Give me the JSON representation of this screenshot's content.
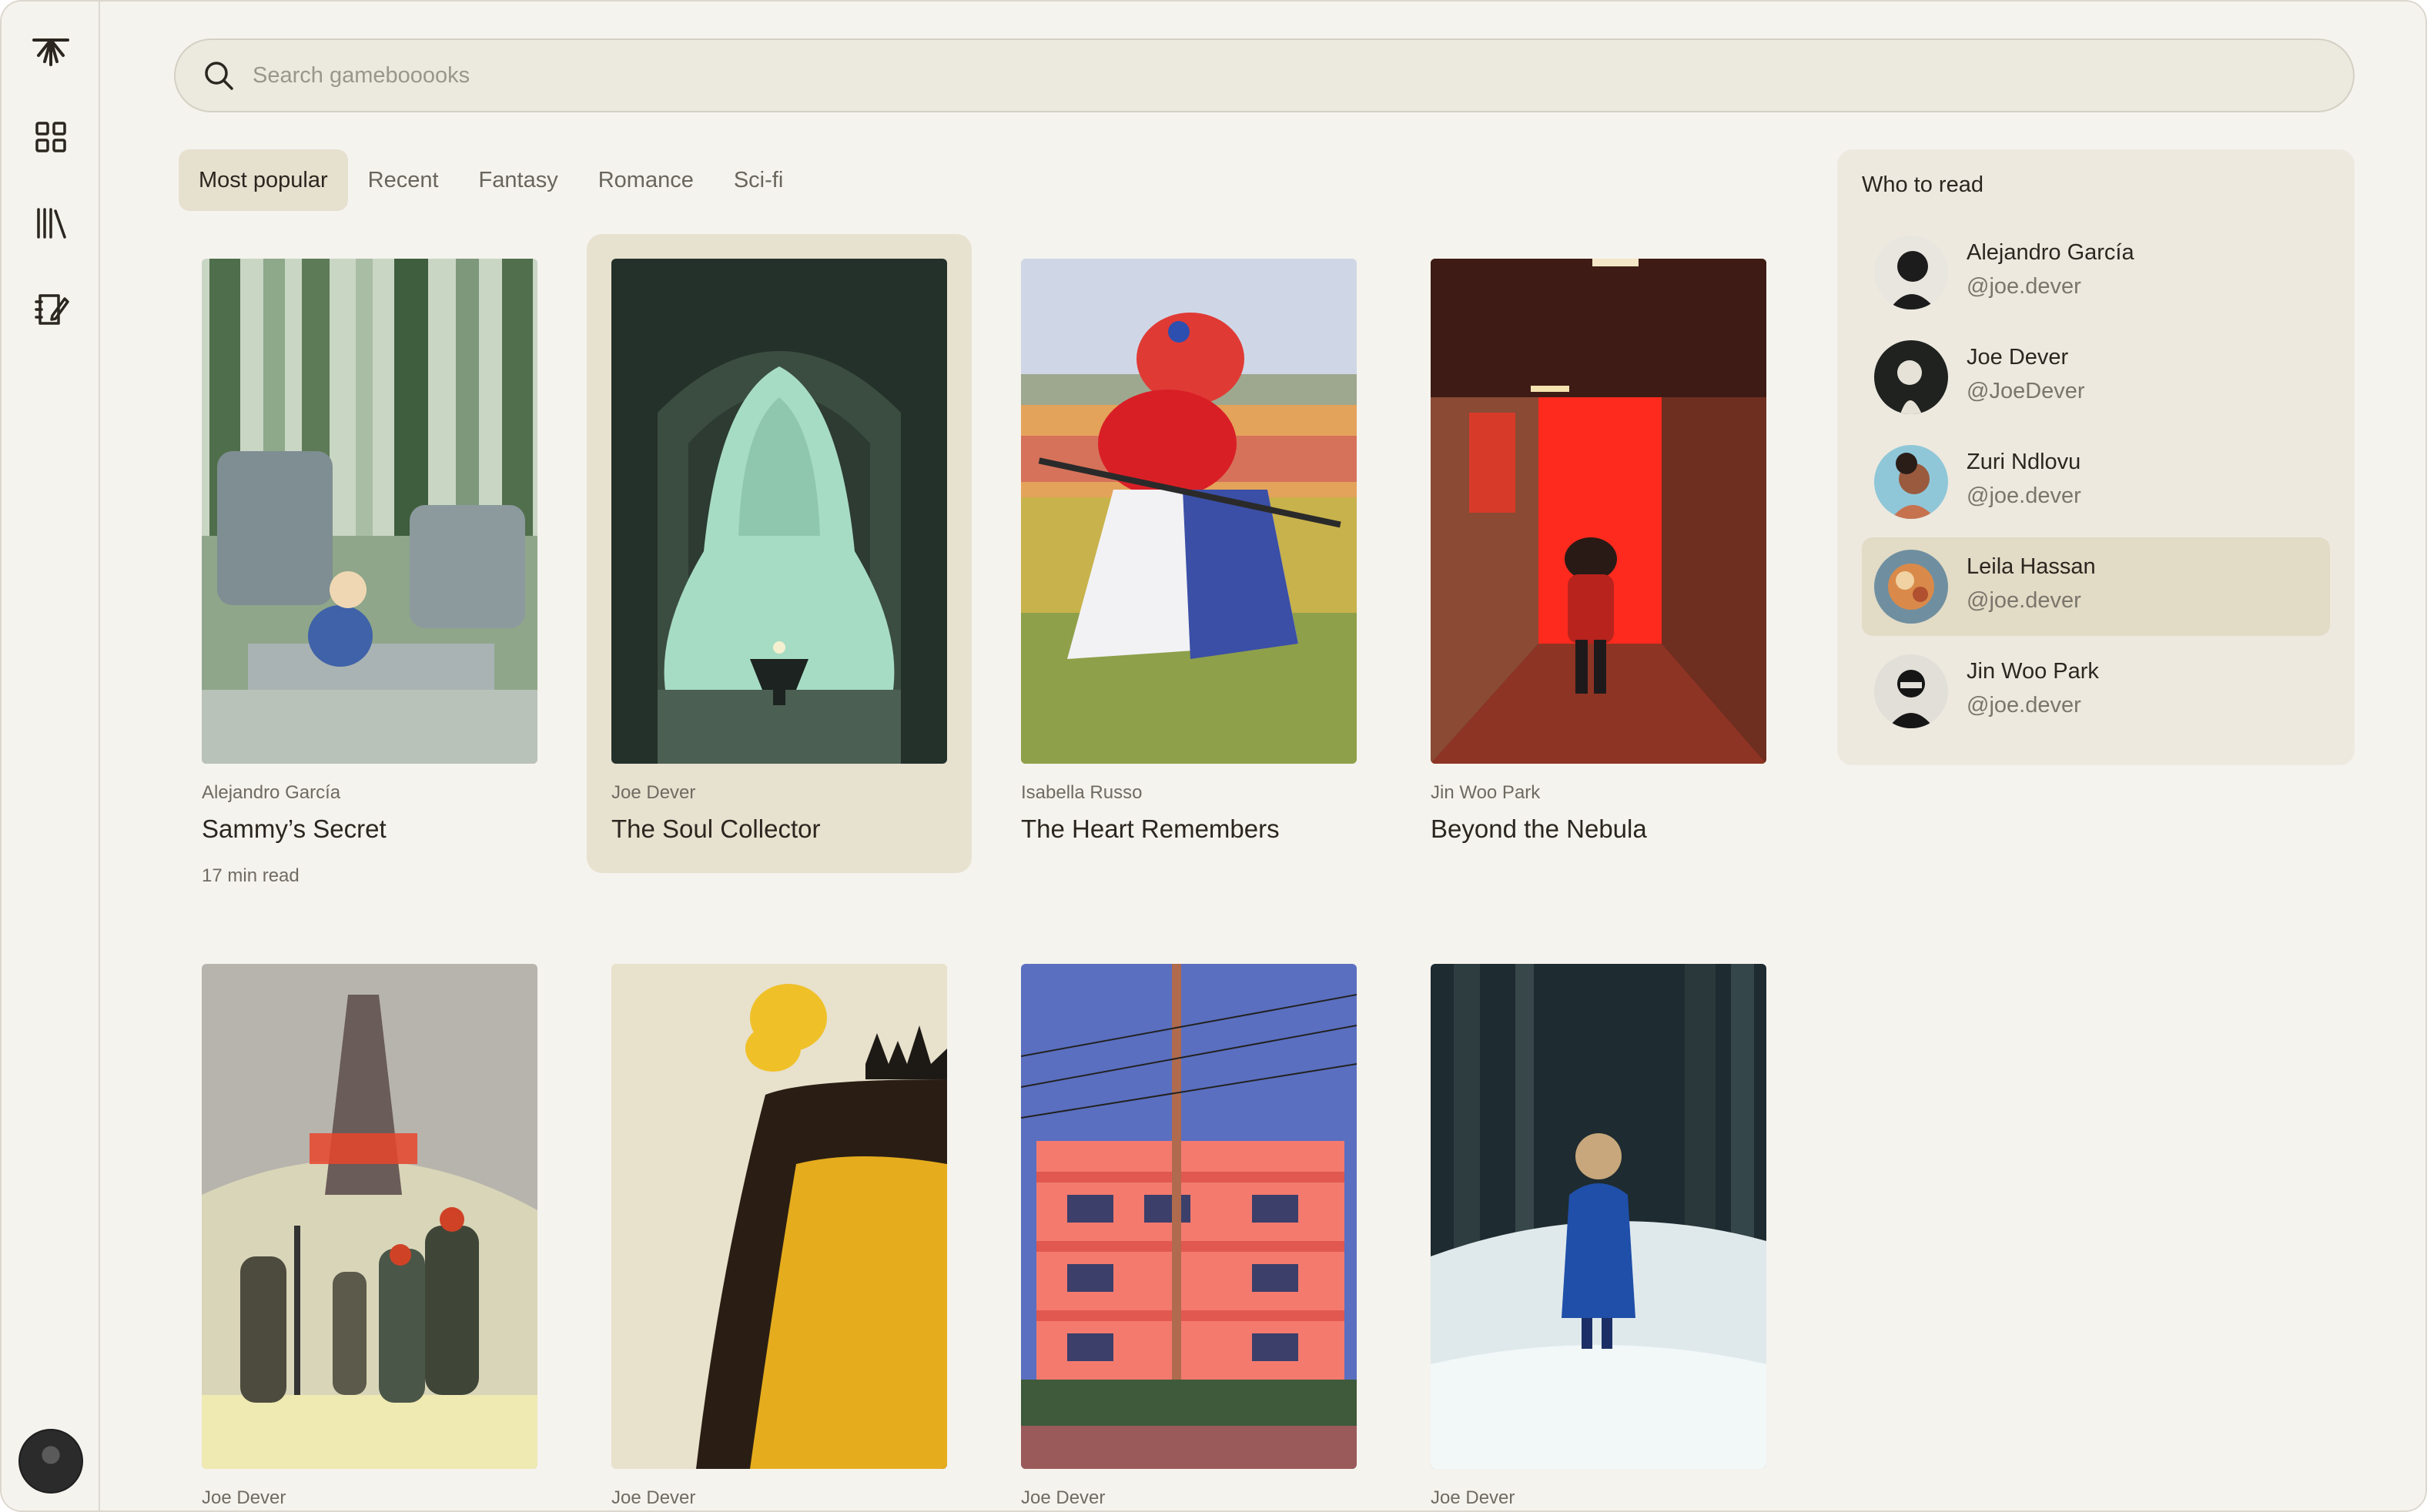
{
  "search": {
    "placeholder": "Search gamebooooks"
  },
  "sidebar": {
    "items": [
      {
        "icon": "logo-icon"
      },
      {
        "icon": "grid-icon"
      },
      {
        "icon": "library-icon"
      },
      {
        "icon": "notebook-edit-icon"
      }
    ]
  },
  "tabs": [
    {
      "label": "Most popular",
      "active": true
    },
    {
      "label": "Recent"
    },
    {
      "label": "Fantasy"
    },
    {
      "label": "Romance"
    },
    {
      "label": "Sci-fi"
    }
  ],
  "books": [
    {
      "author": "Alejandro García",
      "title": "Sammy’s Secret",
      "read_time": "17 min read"
    },
    {
      "author": "Joe Dever",
      "title": "The Soul Collector"
    },
    {
      "author": "Isabella Russo",
      "title": "The Heart Remembers"
    },
    {
      "author": "Jin Woo Park",
      "title": "Beyond the Nebula"
    },
    {
      "author": "Joe Dever"
    },
    {
      "author": "Joe Dever"
    },
    {
      "author": "Joe Dever"
    },
    {
      "author": "Joe Dever"
    }
  ],
  "who_to_read": {
    "title": "Who to read",
    "people": [
      {
        "name": "Alejandro García",
        "handle": "@joe.dever"
      },
      {
        "name": "Joe Dever",
        "handle": "@JoeDever"
      },
      {
        "name": "Zuri Ndlovu",
        "handle": "@joe.dever"
      },
      {
        "name": "Leila Hassan",
        "handle": "@joe.dever"
      },
      {
        "name": "Jin Woo Park",
        "handle": "@joe.dever"
      }
    ]
  },
  "colors": {
    "background": "#f5f3ee",
    "active_tab": "#e6e0cf",
    "panel": "#ede9df",
    "text": "#2b261f"
  }
}
